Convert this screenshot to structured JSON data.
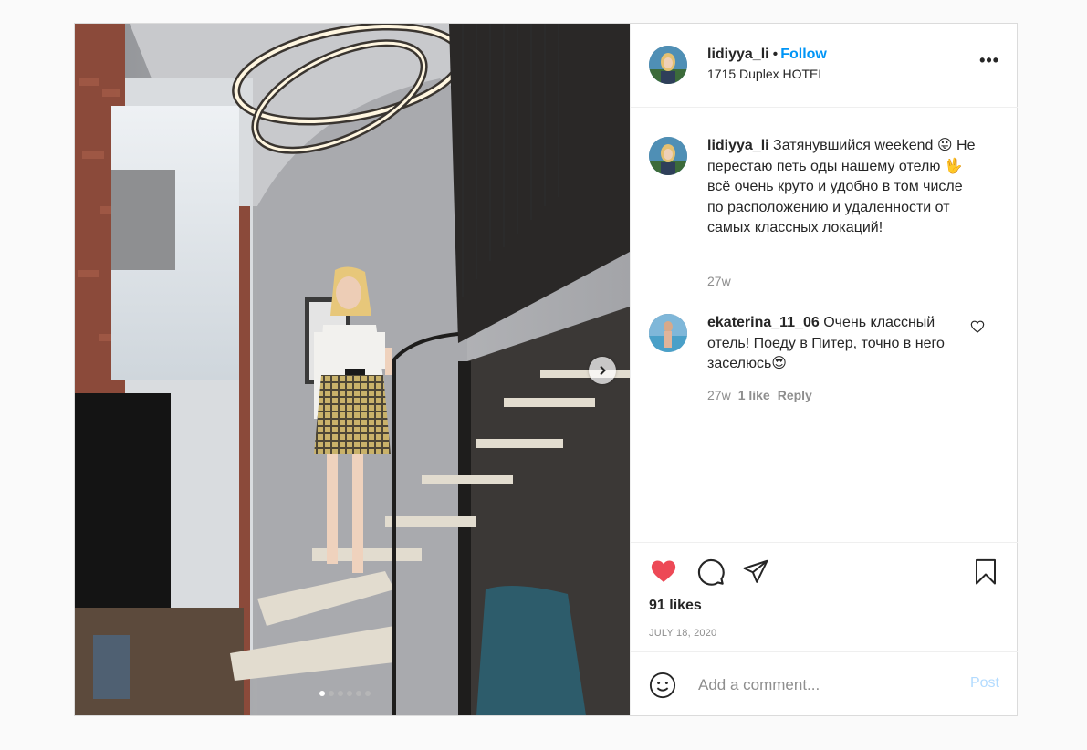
{
  "post": {
    "username": "lidiyya_li",
    "separator": "•",
    "follow_label": "Follow",
    "location": "1715 Duplex HOTEL",
    "more_label": "•••"
  },
  "caption": {
    "username": "lidiyya_li",
    "text": "Затянувшийся weekend 😛 Не перестаю петь оды нашему отелю 🖖 всё очень круто и удобно в том числе по расположению и удаленности от самых классных локаций!",
    "time": "27w"
  },
  "comments": [
    {
      "username": "ekaterina_11_06",
      "text": "Очень классный отель! Поеду в Питер, точно в него заселюсь😍",
      "time": "27w",
      "likes": "1 like",
      "reply_label": "Reply"
    }
  ],
  "stats": {
    "likes": "91 likes",
    "date": "JULY 18, 2020"
  },
  "add_comment": {
    "placeholder": "Add a comment...",
    "post_label": "Post"
  },
  "carousel": {
    "total": 6,
    "active": 1
  },
  "colors": {
    "like_red": "#ed4956",
    "follow_blue": "#0095f6",
    "post_disabled": "#b3dbff"
  },
  "icons": [
    "heart-filled-icon",
    "comment-icon",
    "share-icon",
    "bookmark-icon",
    "heart-outline-icon",
    "emoji-icon",
    "chevron-right-icon",
    "more-icon"
  ]
}
